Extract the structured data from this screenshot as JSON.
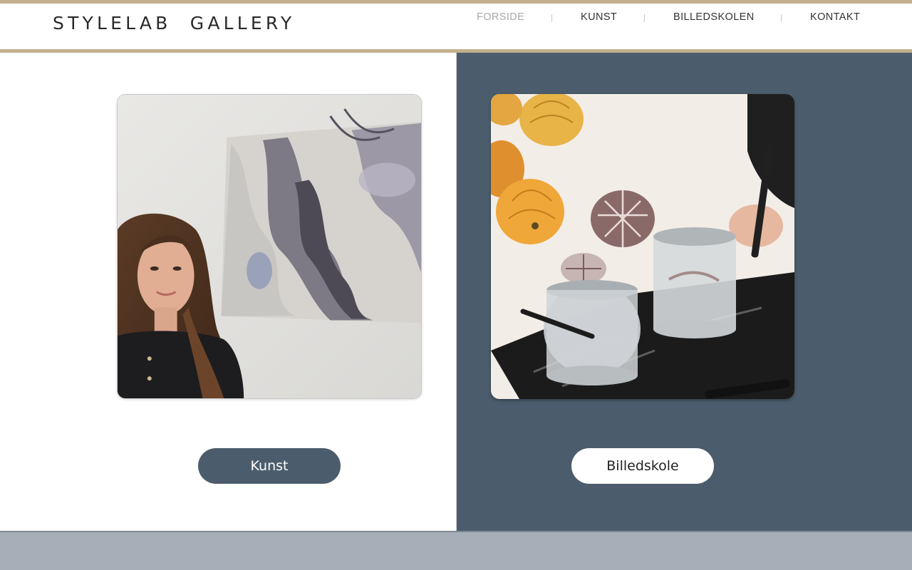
{
  "header": {
    "logo": "STYLELAB  GALLERY",
    "nav": [
      {
        "label": "FORSIDE",
        "active": true
      },
      {
        "label": "KUNST",
        "active": false
      },
      {
        "label": "BILLEDSKOLEN",
        "active": false
      },
      {
        "label": "KONTAKT",
        "active": false
      }
    ]
  },
  "left": {
    "image": "artist-portrait-with-painting",
    "button_label": "Kunst"
  },
  "right": {
    "image": "art-class-pumpkins-and-jars",
    "button_label": "Billedskole"
  },
  "colors": {
    "accent_gold": "#c2b08d",
    "slate_blue": "#4b5d6c",
    "footer_gray": "#a6aeb7"
  }
}
